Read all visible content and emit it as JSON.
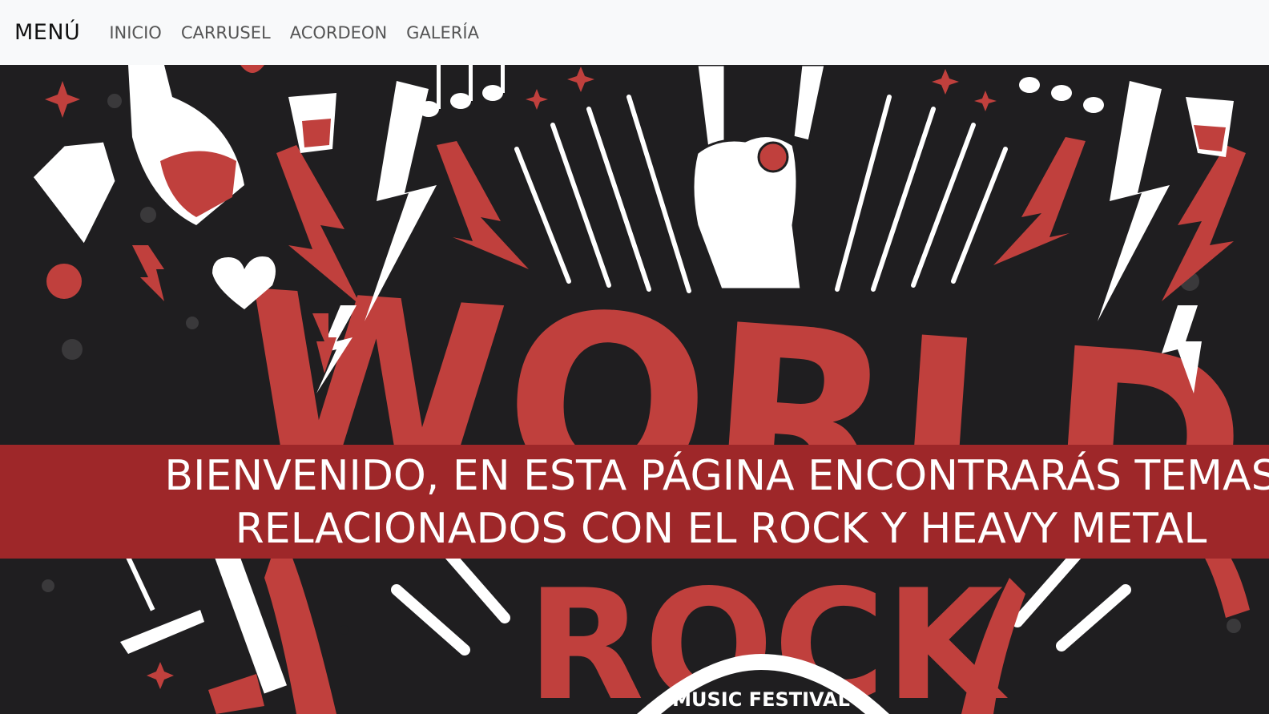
{
  "navbar": {
    "brand": "MENÚ",
    "links": [
      {
        "label": "INICIO"
      },
      {
        "label": "CARRUSEL"
      },
      {
        "label": "ACORDEON"
      },
      {
        "label": "GALERÍA"
      }
    ]
  },
  "hero": {
    "poster_lettering": [
      "WORLD",
      "ROCK",
      "MUSIC FESTIVAL"
    ],
    "banner": {
      "line1": "BIENVENIDO, EN ESTA PÁGINA ENCONTRARÁS TEMAS",
      "line2": "RELACIONADOS CON EL ROCK Y HEAVY METAL"
    }
  },
  "colors": {
    "nav_bg": "#f8f9fa",
    "poster_bg": "#1f1e20",
    "accent_red": "#c0403d",
    "banner_bg": "#9e2729",
    "banner_text": "#ffffff"
  }
}
